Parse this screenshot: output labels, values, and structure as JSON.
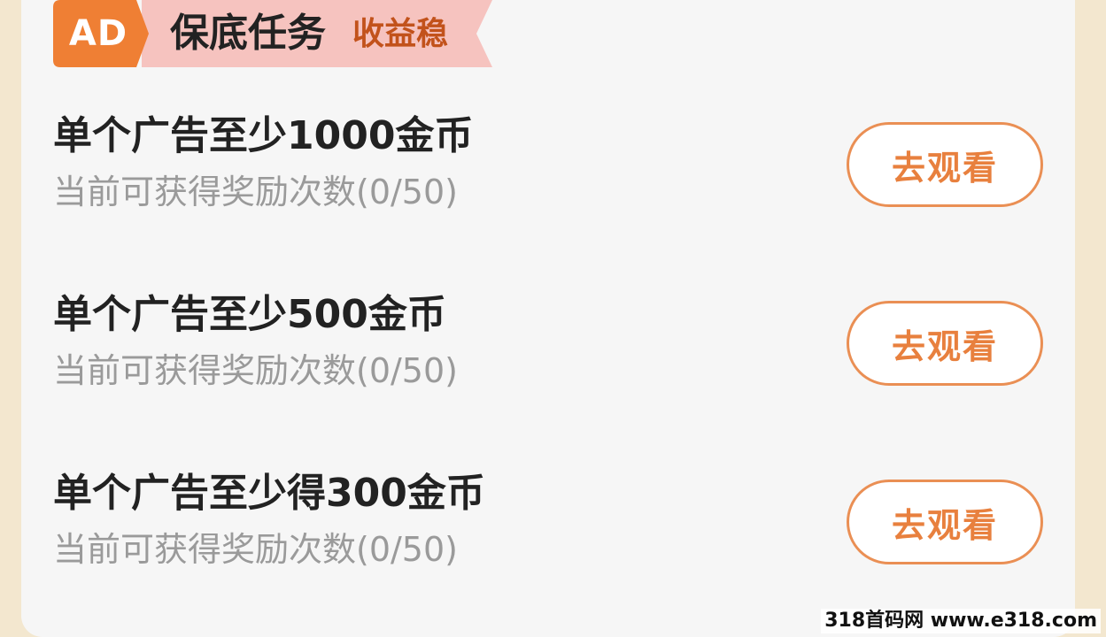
{
  "banner": {
    "badge": "AD",
    "title": "保底任务",
    "subtitle": "收益稳"
  },
  "tasks": [
    {
      "title": "单个广告至少1000金币",
      "progress": "当前可获得奖励次数(0/50)",
      "button": "去观看"
    },
    {
      "title": "单个广告至少500金币",
      "progress": "当前可获得奖励次数(0/50)",
      "button": "去观看"
    },
    {
      "title": "单个广告至少得300金币",
      "progress": "当前可获得奖励次数(0/50)",
      "button": "去观看"
    }
  ],
  "watermark": "318首码网 www.e318.com",
  "colors": {
    "page_bg": "#f3e7cf",
    "card_bg": "#f6f6f6",
    "badge_orange": "#ef7f34",
    "banner_pink": "#f6c3bf",
    "accent": "#e8803e"
  }
}
